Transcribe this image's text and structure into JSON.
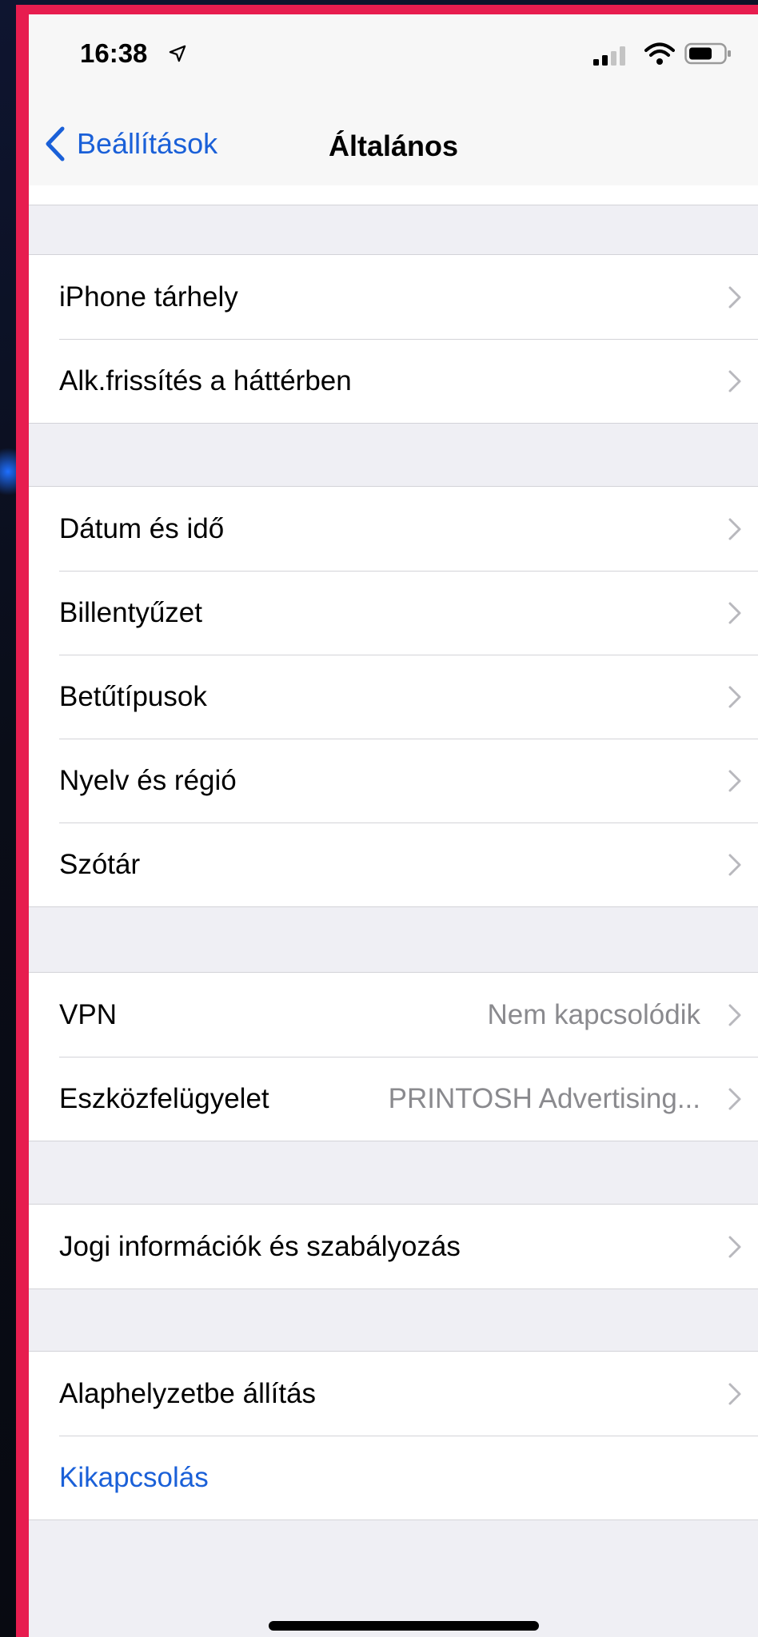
{
  "status_bar": {
    "time": "16:38"
  },
  "nav": {
    "back_label": "Beállítások",
    "title": "Általános"
  },
  "groups": [
    {
      "rows": [
        {
          "label": "iPhone tárhely"
        },
        {
          "label": "Alk.frissítés a háttérben"
        }
      ]
    },
    {
      "rows": [
        {
          "label": "Dátum és idő"
        },
        {
          "label": "Billentyűzet"
        },
        {
          "label": "Betűtípusok"
        },
        {
          "label": "Nyelv és régió"
        },
        {
          "label": "Szótár"
        }
      ]
    },
    {
      "rows": [
        {
          "label": "VPN",
          "value": "Nem kapcsolódik"
        },
        {
          "label": "Eszközfelügyelet",
          "value": "PRINTOSH Advertising..."
        }
      ]
    },
    {
      "rows": [
        {
          "label": "Jogi információk és szabályozás"
        }
      ]
    },
    {
      "rows": [
        {
          "label": "Alaphelyzetbe állítás"
        },
        {
          "label": "Kikapcsolás"
        }
      ]
    }
  ],
  "colors": {
    "accent": "#1a60d8",
    "frame": "#e71d4f",
    "background": "#efeff4"
  }
}
